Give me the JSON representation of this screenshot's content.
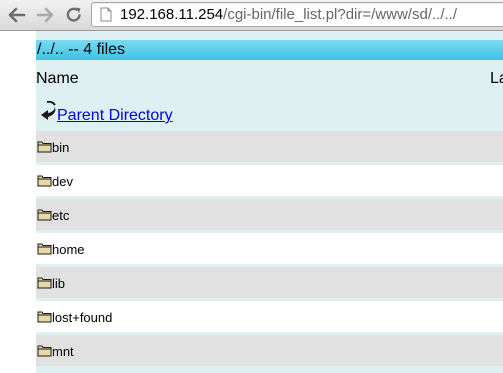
{
  "browser": {
    "url_host": "192.168.11.254",
    "url_path": "/cgi-bin/file_list.pl?dir=/www/sd/../../"
  },
  "page": {
    "title": "/../.. -- 4 files",
    "columns": {
      "name": "Name",
      "last_modified_partial": "La"
    },
    "parent_link": "Parent Directory",
    "entries": [
      {
        "name": "bin"
      },
      {
        "name": "dev"
      },
      {
        "name": "etc"
      },
      {
        "name": "home"
      },
      {
        "name": "lib"
      },
      {
        "name": "lost+found"
      },
      {
        "name": "mnt"
      }
    ]
  },
  "colors": {
    "title_bar": "#3dc2e8",
    "page_background": "#dff0f3",
    "row_gray": "#e1e1e1",
    "row_white": "#ffffff",
    "link": "#0000ee"
  }
}
